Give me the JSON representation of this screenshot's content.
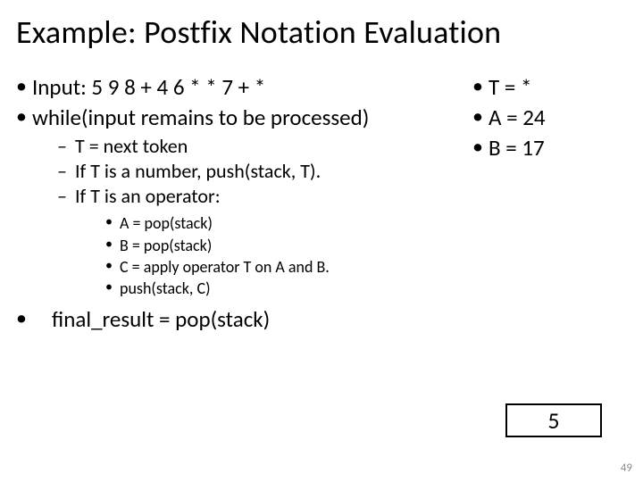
{
  "title": "Example: Postfix Notation Evaluation",
  "left": {
    "l1a": "Input:   5 9 8 + 4 6 * * 7 + *",
    "l1b": "while(input remains to be processed)",
    "l2a": "T = next token",
    "l2b": "If T is a number, push(stack, T).",
    "l2c": "If T is an operator:",
    "l3a": "A = pop(stack)",
    "l3b": "B = pop(stack)",
    "l3c": "C = apply operator T on A and B.",
    "l3d": "push(stack, C)",
    "final": "final_result = pop(stack)"
  },
  "right": {
    "r1": "T = *",
    "r2": "A = 24",
    "r3": "B = 17"
  },
  "stack_value": "5",
  "page_number": "49"
}
